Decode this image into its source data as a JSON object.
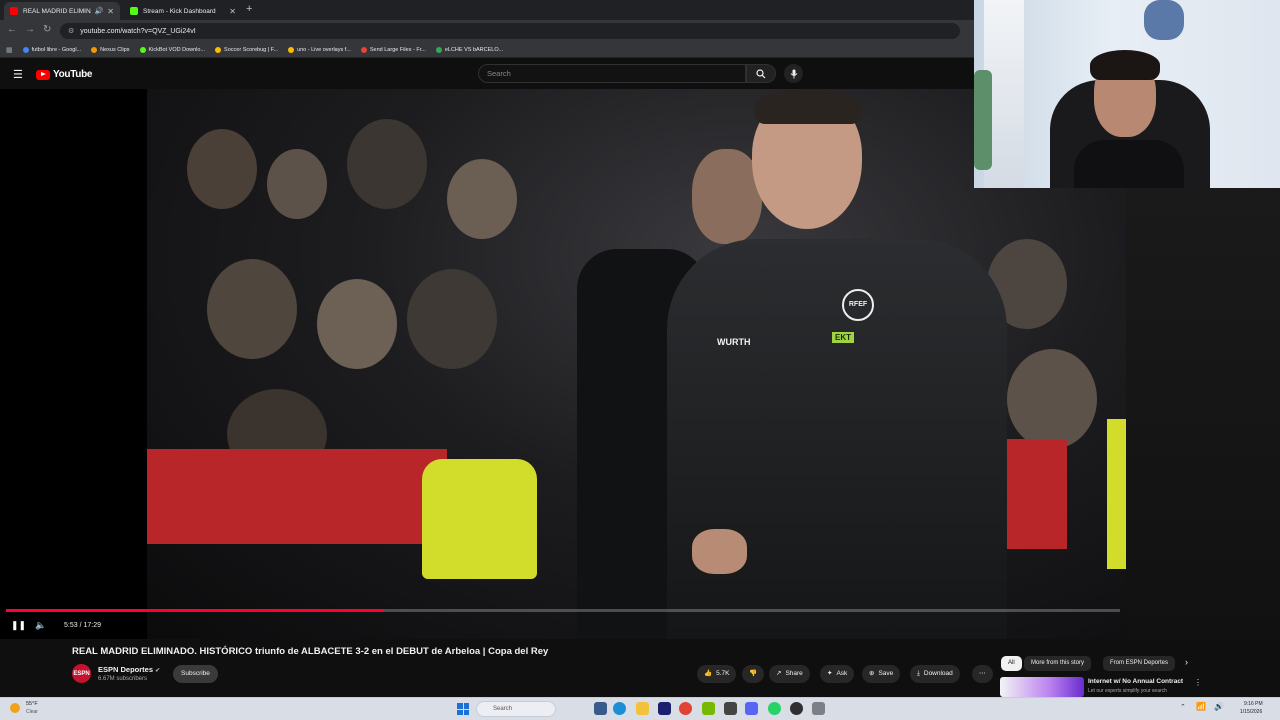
{
  "browser": {
    "tabs": [
      {
        "title": "REAL MADRID ELIMINADO.",
        "active": true,
        "favicon_color": "#ff0000"
      },
      {
        "title": "Stream - Kick Dashboard",
        "active": false,
        "favicon_color": "#53fc18"
      }
    ],
    "new_tab": "+",
    "url": "youtube.com/watch?v=QVZ_UGi24vI",
    "bookmarks": [
      {
        "label": "futbol libre - Googl...",
        "color": "#4285f4"
      },
      {
        "label": "Nexus Clips",
        "color": "#f29900"
      },
      {
        "label": "KickBot VOD Downlo...",
        "color": "#53fc18"
      },
      {
        "label": "Soccer Scorebug | F...",
        "color": "#fbbc04"
      },
      {
        "label": "uno - Live overlays f...",
        "color": "#fbbc04"
      },
      {
        "label": "Send Large Files - Fr...",
        "color": "#ea4335"
      },
      {
        "label": "eLCHE VS bARCELO...",
        "color": "#34a853"
      }
    ]
  },
  "masthead": {
    "logo_text": "YouTube",
    "search_placeholder": "Search"
  },
  "player": {
    "progress": 0.339,
    "time_current": "5:53",
    "time_total": "17:29",
    "time_display": "5:53 / 17:29"
  },
  "video": {
    "title": "REAL MADRID ELIMINADO. HISTÓRICO triunfo de ALBACETE 3-2 en el DEBUT de Arbeloa | Copa del Rey",
    "channel": "ESPN Deportes",
    "channel_avatar": "ESPN",
    "subscribers": "6.67M subscribers",
    "subscribe_label": "Subscribe",
    "likes": "5.7K",
    "share_label": "Share",
    "ask_label": "Ask",
    "save_label": "Save",
    "download_label": "Download",
    "overlay_logos": [
      "WURTH",
      "RFEF",
      "EKT"
    ]
  },
  "sidebar": {
    "chips": [
      "All",
      "More from this story",
      "From ESPN Deportes"
    ],
    "ad_title": "Internet w/ No Annual Contract",
    "ad_sub": "Let our experts simplify your search"
  },
  "taskbar": {
    "temp": "55°F",
    "weather": "Clear",
    "search_placeholder": "Search",
    "time": "9:16 PM",
    "date": "1/15/2026"
  },
  "colors": {
    "brand_red": "#ff0000",
    "progress_red": "#ff0033",
    "background": "#0f0f0f"
  }
}
